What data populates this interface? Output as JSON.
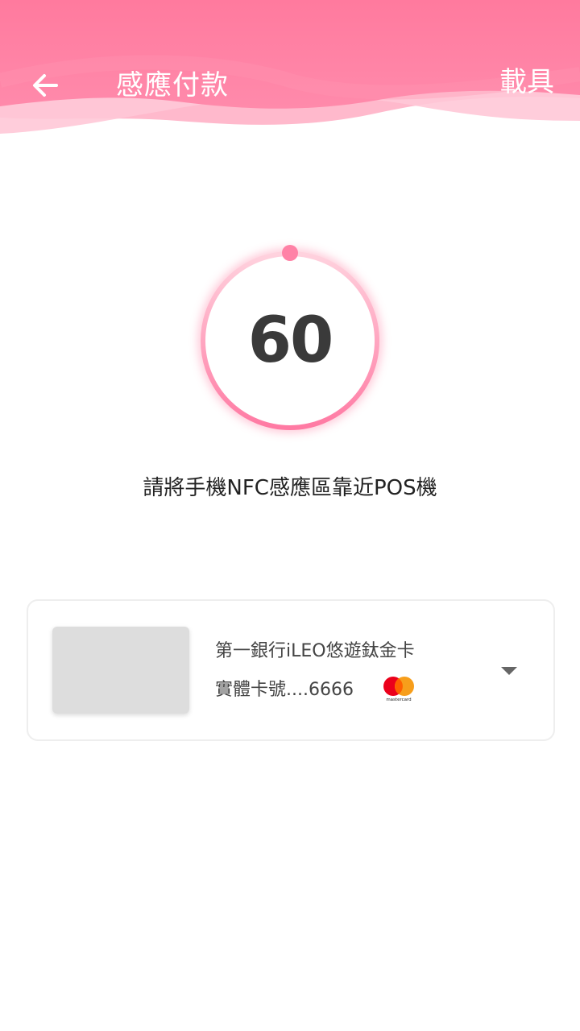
{
  "header": {
    "title": "感應付款",
    "carrier_label": "載具"
  },
  "countdown": {
    "value": "60"
  },
  "instruction": "請將手機NFC感應區靠近POS機",
  "card": {
    "name": "第一銀行iLEO悠遊鈦金卡",
    "number": "實體卡號....6666",
    "brand_icon": "mastercard-icon",
    "brand_text": "mastercard"
  },
  "colors": {
    "header_pink": "#ff7aa0",
    "accent_pink": "#ff84a8",
    "text_dark": "#3a3a3a"
  }
}
